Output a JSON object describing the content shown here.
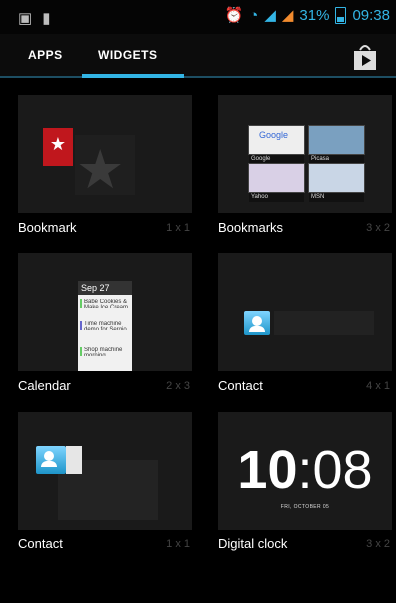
{
  "status": {
    "battery_percent": "31%",
    "time": "09:38"
  },
  "tabs": {
    "apps": "APPS",
    "widgets": "WIDGETS"
  },
  "widgets": [
    {
      "name": "Bookmark",
      "size": "1 x 1"
    },
    {
      "name": "Bookmarks",
      "size": "3 x 2"
    },
    {
      "name": "Calendar",
      "size": "2 x 3"
    },
    {
      "name": "Contact",
      "size": "4 x 1"
    },
    {
      "name": "Contact",
      "size": "1 x 1"
    },
    {
      "name": "Digital clock",
      "size": "3 x 2"
    }
  ],
  "previews": {
    "bookmarks_thumbs": [
      "Google",
      "Picasa",
      "Yahoo",
      "MSN"
    ],
    "calendar": {
      "date": "Sep 27",
      "events": [
        "Babe Cookies & Make Ice Cream",
        "Time machine demo for Sergio",
        "Shop machine morning"
      ]
    },
    "clock": {
      "hours": "10",
      "minutes": "08",
      "date": "FRI, OCTOBER 05"
    }
  },
  "colors": {
    "accent": "#33b5e5",
    "card": "#1a1a1a",
    "bookmark_red": "#c0171d"
  }
}
